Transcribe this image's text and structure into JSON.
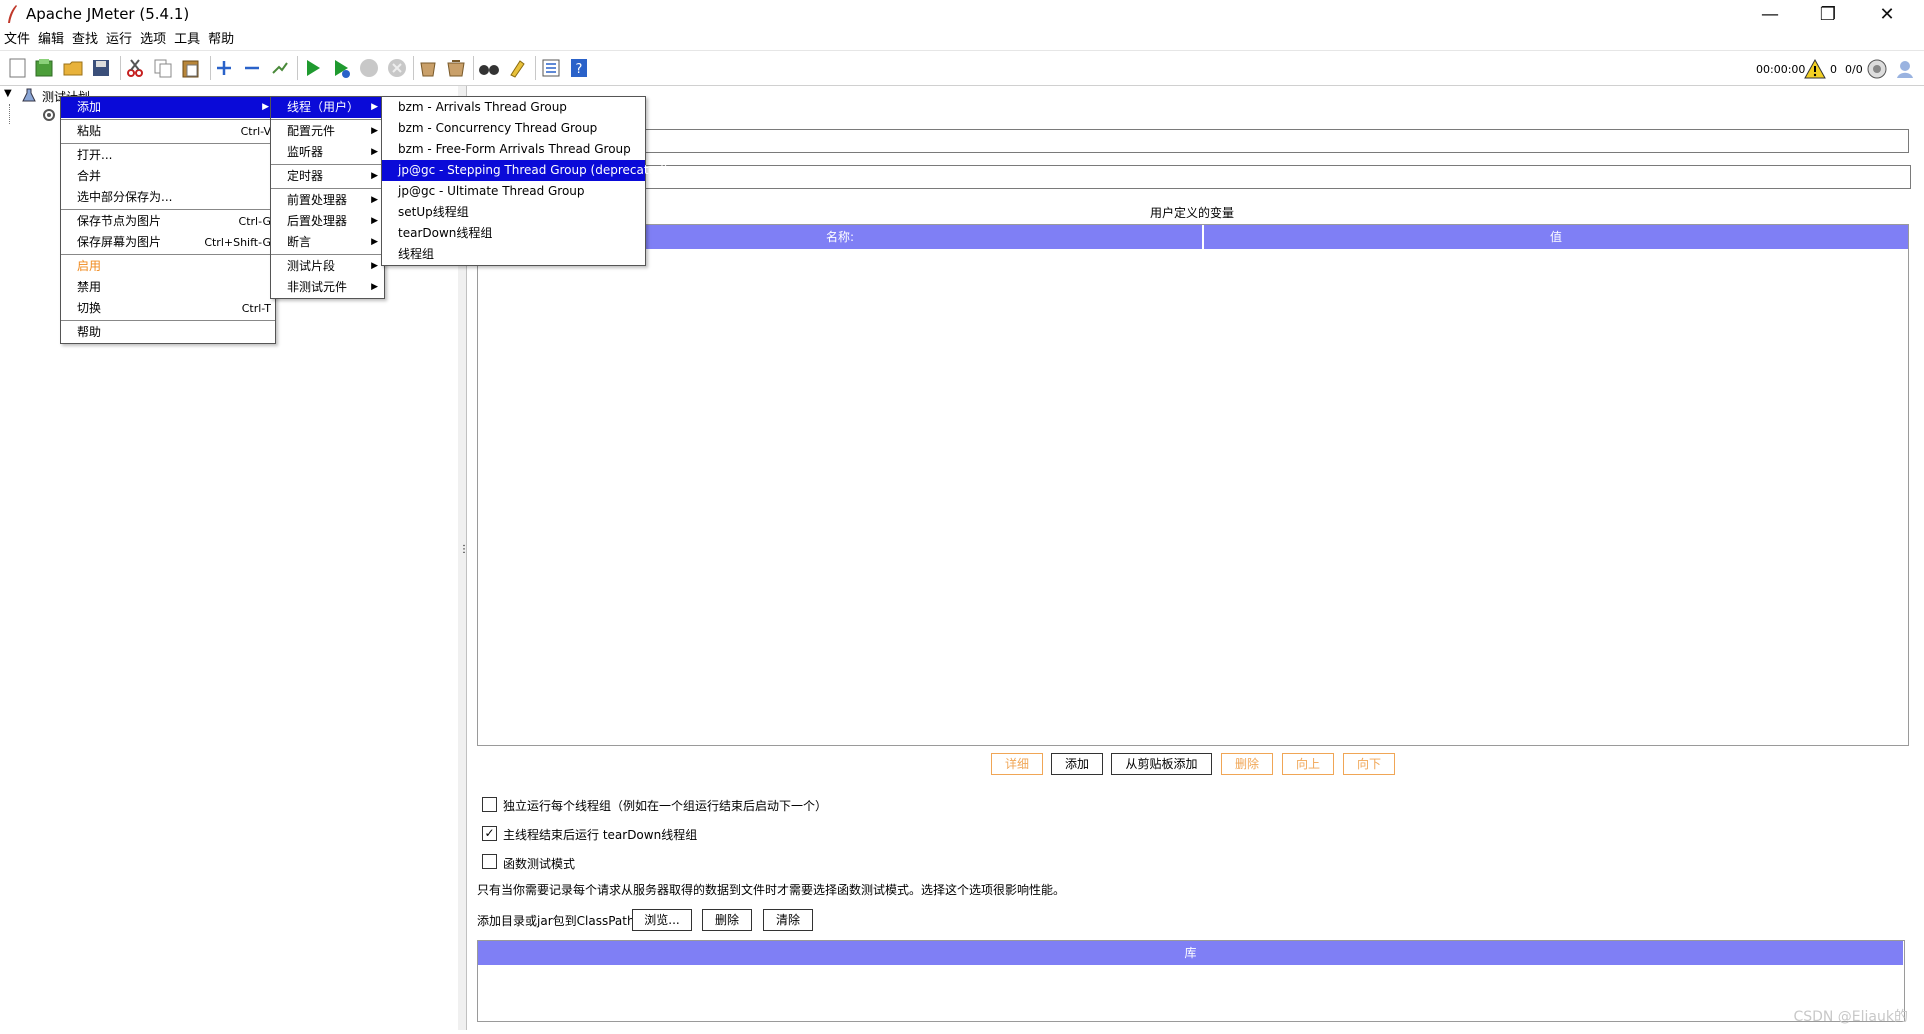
{
  "window": {
    "title": "Apache JMeter (5.4.1)",
    "minimize": "—",
    "maximize": "❐",
    "close": "✕"
  },
  "menubar": [
    "文件",
    "编辑",
    "查找",
    "运行",
    "选项",
    "工具",
    "帮助"
  ],
  "toolbar": {
    "timer": "00:00:00",
    "warnings": "0",
    "threads": "0/0"
  },
  "tree": {
    "root_label": "测试计划"
  },
  "context_menu": {
    "items": [
      {
        "label": "添加",
        "shortcut": "",
        "submenu": true
      },
      {
        "label": "粘贴",
        "shortcut": "Ctrl-V"
      },
      {
        "label": "打开...",
        "shortcut": ""
      },
      {
        "label": "合并",
        "shortcut": ""
      },
      {
        "label": "选中部分保存为...",
        "shortcut": ""
      },
      {
        "label": "保存节点为图片",
        "shortcut": "Ctrl-G"
      },
      {
        "label": "保存屏幕为图片",
        "shortcut": "Ctrl+Shift-G"
      },
      {
        "label": "启用",
        "shortcut": ""
      },
      {
        "label": "禁用",
        "shortcut": ""
      },
      {
        "label": "切换",
        "shortcut": "Ctrl-T"
      },
      {
        "label": "帮助",
        "shortcut": ""
      }
    ]
  },
  "add_submenu": {
    "items": [
      "线程（用户）",
      "配置元件",
      "监听器",
      "定时器",
      "前置处理器",
      "后置处理器",
      "断言",
      "测试片段",
      "非测试元件"
    ]
  },
  "thread_submenu": {
    "items": [
      "bzm - Arrivals Thread Group",
      "bzm - Concurrency Thread Group",
      "bzm - Free-Form Arrivals Thread Group",
      "jp@gc - Stepping Thread Group (deprecated)",
      "jp@gc - Ultimate Thread Group",
      "setUp线程组",
      "tearDown线程组",
      "线程组"
    ]
  },
  "test_plan": {
    "udv_title": "用户定义的变量",
    "col_name": "名称:",
    "col_value": "值",
    "buttons": {
      "detail": "详细",
      "add": "添加",
      "add_clipboard": "从剪贴板添加",
      "delete": "删除",
      "up": "向上",
      "down": "向下"
    },
    "checkbox_serial": "独立运行每个线程组（例如在一个组运行结束后启动下一个）",
    "checkbox_teardown": "主线程结束后运行 tearDown线程组",
    "checkbox_functional": "函数测试模式",
    "functional_note": "只有当你需要记录每个请求从服务器取得的数据到文件时才需要选择函数测试模式。选择这个选项很影响性能。",
    "classpath_label": "添加目录或jar包到ClassPath",
    "browse": "浏览...",
    "cp_delete": "删除",
    "cp_clear": "清除",
    "lib_header": "库",
    "checkbox_states": {
      "serial": false,
      "teardown": true,
      "functional": false
    }
  },
  "watermark": "CSDN @Eliauk的"
}
